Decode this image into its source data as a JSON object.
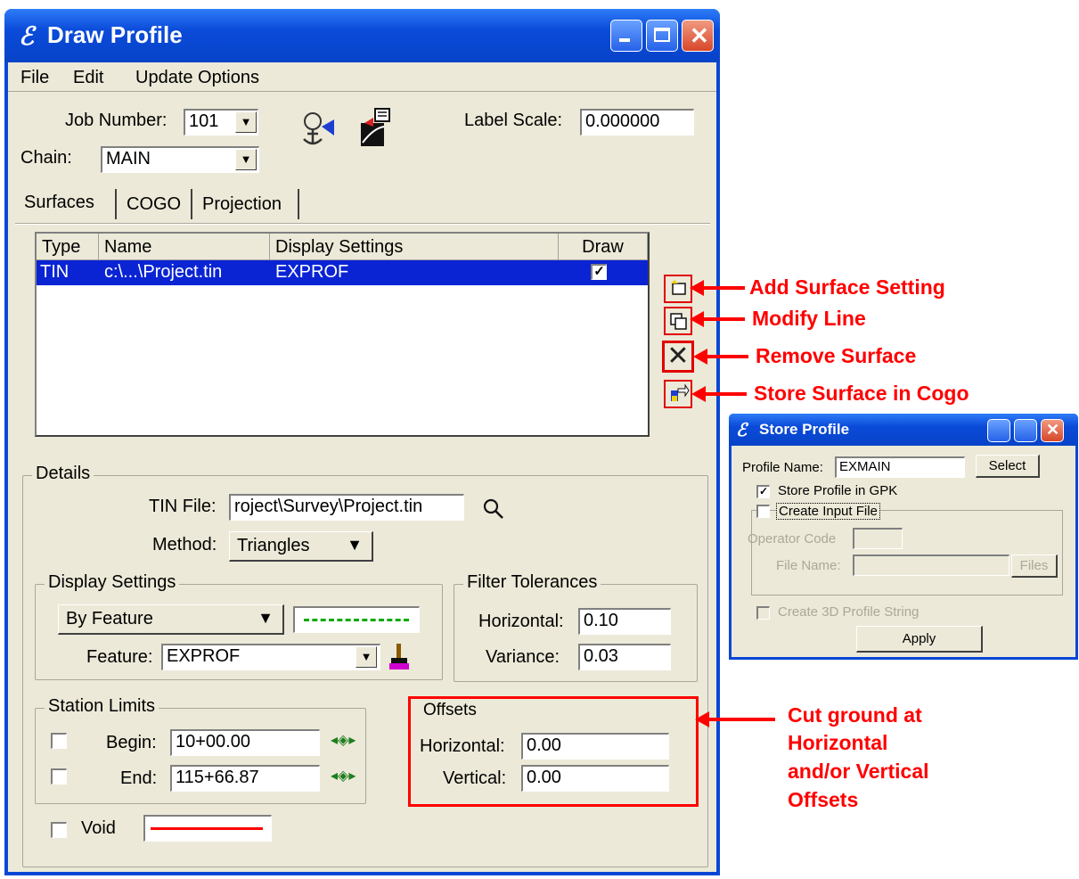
{
  "main_window": {
    "title": "Draw Profile",
    "menu": [
      "File",
      "Edit",
      "Update Options"
    ],
    "job_number": {
      "label": "Job Number:",
      "value": "101"
    },
    "chain": {
      "label": "Chain:",
      "value": "MAIN"
    },
    "label_scale": {
      "label": "Label Scale:",
      "value": "0.000000"
    },
    "tabs": [
      "Surfaces",
      "COGO",
      "Projection"
    ],
    "surfaces_list": {
      "columns": [
        "Type",
        "Name",
        "Display Settings",
        "Draw"
      ],
      "rows": [
        {
          "type": "TIN",
          "name": "c:\\...\\Project.tin",
          "display_settings": "EXPROF",
          "draw": true
        }
      ]
    },
    "details": {
      "group_label": "Details",
      "tin_file": {
        "label": "TIN File:",
        "value": "roject\\Survey\\Project.tin"
      },
      "method": {
        "label": "Method:",
        "value": "Triangles"
      },
      "display_settings": {
        "group_label": "Display Settings",
        "mode": "By Feature",
        "feature": {
          "label": "Feature:",
          "value": "EXPROF"
        },
        "line_color": "#00aa00"
      },
      "filter_tolerances": {
        "group_label": "Filter Tolerances",
        "horizontal": {
          "label": "Horizontal:",
          "value": "0.10"
        },
        "variance": {
          "label": "Variance:",
          "value": "0.03"
        }
      },
      "station_limits": {
        "group_label": "Station Limits",
        "begin": {
          "label": "Begin:",
          "value": "10+00.00",
          "checked": false
        },
        "end": {
          "label": "End:",
          "value": "115+66.87",
          "checked": false
        }
      },
      "offsets": {
        "group_label": "Offsets",
        "horizontal": {
          "label": "Horizontal:",
          "value": "0.00"
        },
        "vertical": {
          "label": "Vertical:",
          "value": "0.00"
        }
      },
      "void": {
        "label": "Void",
        "checked": false,
        "line_color": "#ff0000"
      }
    }
  },
  "annotations": {
    "add_surface": "Add Surface Setting",
    "modify_line": "Modify Line",
    "remove_surface": "Remove Surface",
    "store_surface": "Store Surface in Cogo",
    "offsets_note": [
      "Cut ground at",
      "Horizontal",
      "and/or Vertical",
      "Offsets"
    ]
  },
  "store_profile_window": {
    "title": "Store Profile",
    "profile_name": {
      "label": "Profile Name:",
      "value": "EXMAIN"
    },
    "select_button": "Select",
    "store_in_gpk": {
      "label": "Store Profile in GPK",
      "checked": true
    },
    "create_input_file": {
      "label": "Create Input File",
      "checked": false
    },
    "operator_code": {
      "label": "Operator Code"
    },
    "file_name": {
      "label": "File Name:"
    },
    "files_button": "Files",
    "create_3d": {
      "label": "Create 3D Profile String",
      "checked": false
    },
    "apply_button": "Apply"
  },
  "colors": {
    "accent": "#ff0000",
    "title_bar": "#0a47d6",
    "selection": "#0a24d4"
  }
}
